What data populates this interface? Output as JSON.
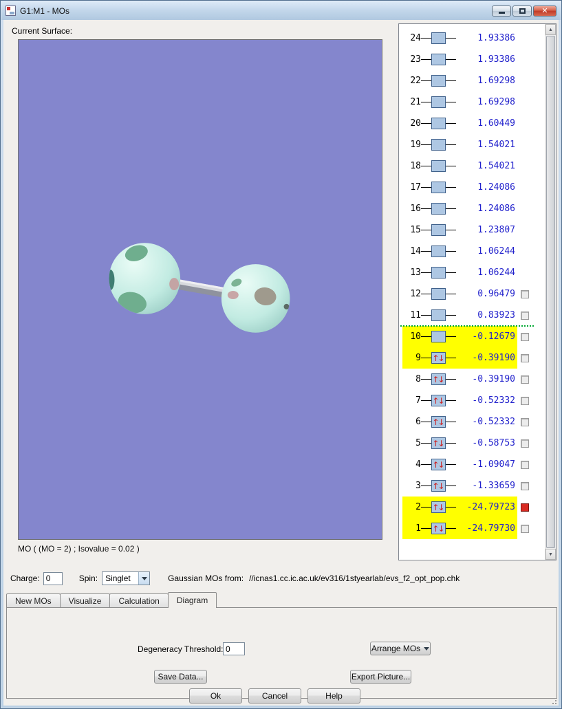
{
  "window": {
    "title": "G1:M1 - MOs"
  },
  "surface": {
    "label": "Current Surface:",
    "caption": "MO ( (MO = 2) ; Isovalue = 0.02 )"
  },
  "mo_panel": {
    "rows": [
      {
        "num": "24",
        "energy": "1.93386",
        "arrows": false,
        "highlight": false,
        "checkbox": "none"
      },
      {
        "num": "23",
        "energy": "1.93386",
        "arrows": false,
        "highlight": false,
        "checkbox": "none"
      },
      {
        "num": "22",
        "energy": "1.69298",
        "arrows": false,
        "highlight": false,
        "checkbox": "none"
      },
      {
        "num": "21",
        "energy": "1.69298",
        "arrows": false,
        "highlight": false,
        "checkbox": "none"
      },
      {
        "num": "20",
        "energy": "1.60449",
        "arrows": false,
        "highlight": false,
        "checkbox": "none"
      },
      {
        "num": "19",
        "energy": "1.54021",
        "arrows": false,
        "highlight": false,
        "checkbox": "none"
      },
      {
        "num": "18",
        "energy": "1.54021",
        "arrows": false,
        "highlight": false,
        "checkbox": "none"
      },
      {
        "num": "17",
        "energy": "1.24086",
        "arrows": false,
        "highlight": false,
        "checkbox": "none"
      },
      {
        "num": "16",
        "energy": "1.24086",
        "arrows": false,
        "highlight": false,
        "checkbox": "none"
      },
      {
        "num": "15",
        "energy": "1.23807",
        "arrows": false,
        "highlight": false,
        "checkbox": "none"
      },
      {
        "num": "14",
        "energy": "1.06244",
        "arrows": false,
        "highlight": false,
        "checkbox": "none"
      },
      {
        "num": "13",
        "energy": "1.06244",
        "arrows": false,
        "highlight": false,
        "checkbox": "none"
      },
      {
        "num": "12",
        "energy": "0.96479",
        "arrows": false,
        "highlight": false,
        "checkbox": "empty"
      },
      {
        "num": "11",
        "energy": "0.83923",
        "arrows": false,
        "highlight": false,
        "checkbox": "empty"
      },
      {
        "num": "10",
        "energy": "-0.12679",
        "arrows": false,
        "highlight": true,
        "checkbox": "empty",
        "gap_above": true
      },
      {
        "num": "9",
        "energy": "-0.39190",
        "arrows": true,
        "highlight": true,
        "checkbox": "empty"
      },
      {
        "num": "8",
        "energy": "-0.39190",
        "arrows": true,
        "highlight": false,
        "checkbox": "empty"
      },
      {
        "num": "7",
        "energy": "-0.52332",
        "arrows": true,
        "highlight": false,
        "checkbox": "empty"
      },
      {
        "num": "6",
        "energy": "-0.52332",
        "arrows": true,
        "highlight": false,
        "checkbox": "empty"
      },
      {
        "num": "5",
        "energy": "-0.58753",
        "arrows": true,
        "highlight": false,
        "checkbox": "empty"
      },
      {
        "num": "4",
        "energy": "-1.09047",
        "arrows": true,
        "highlight": false,
        "checkbox": "empty"
      },
      {
        "num": "3",
        "energy": "-1.33659",
        "arrows": true,
        "highlight": false,
        "checkbox": "empty"
      },
      {
        "num": "2",
        "energy": "-24.79723",
        "arrows": true,
        "highlight": true,
        "checkbox": "red"
      },
      {
        "num": "1",
        "energy": "-24.79730",
        "arrows": true,
        "highlight": true,
        "checkbox": "empty"
      }
    ]
  },
  "settings": {
    "charge_label": "Charge:",
    "charge_value": "0",
    "spin_label": "Spin:",
    "spin_value": "Singlet",
    "source_label": "Gaussian MOs from:",
    "source_path": "//icnas1.cc.ic.ac.uk/ev316/1styearlab/evs_f2_opt_pop.chk"
  },
  "tabs": {
    "items": [
      "New MOs",
      "Visualize",
      "Calculation",
      "Diagram"
    ],
    "active": "Diagram"
  },
  "diagram_tab": {
    "degeneracy_label": "Degeneracy Threshold:",
    "degeneracy_value": "0",
    "arrange_button": "Arrange MOs",
    "save_button": "Save Data...",
    "export_button": "Export Picture..."
  },
  "footer": {
    "ok": "Ok",
    "cancel": "Cancel",
    "help": "Help"
  },
  "colors": {
    "viewport_bg": "#8486cd",
    "highlight": "#ffff00",
    "energy_text": "#2121cc",
    "arrow_red": "#cc2020",
    "box_fill": "#aec7e3",
    "gap_line_green": "#00a832",
    "checked_red": "#d82a22"
  }
}
